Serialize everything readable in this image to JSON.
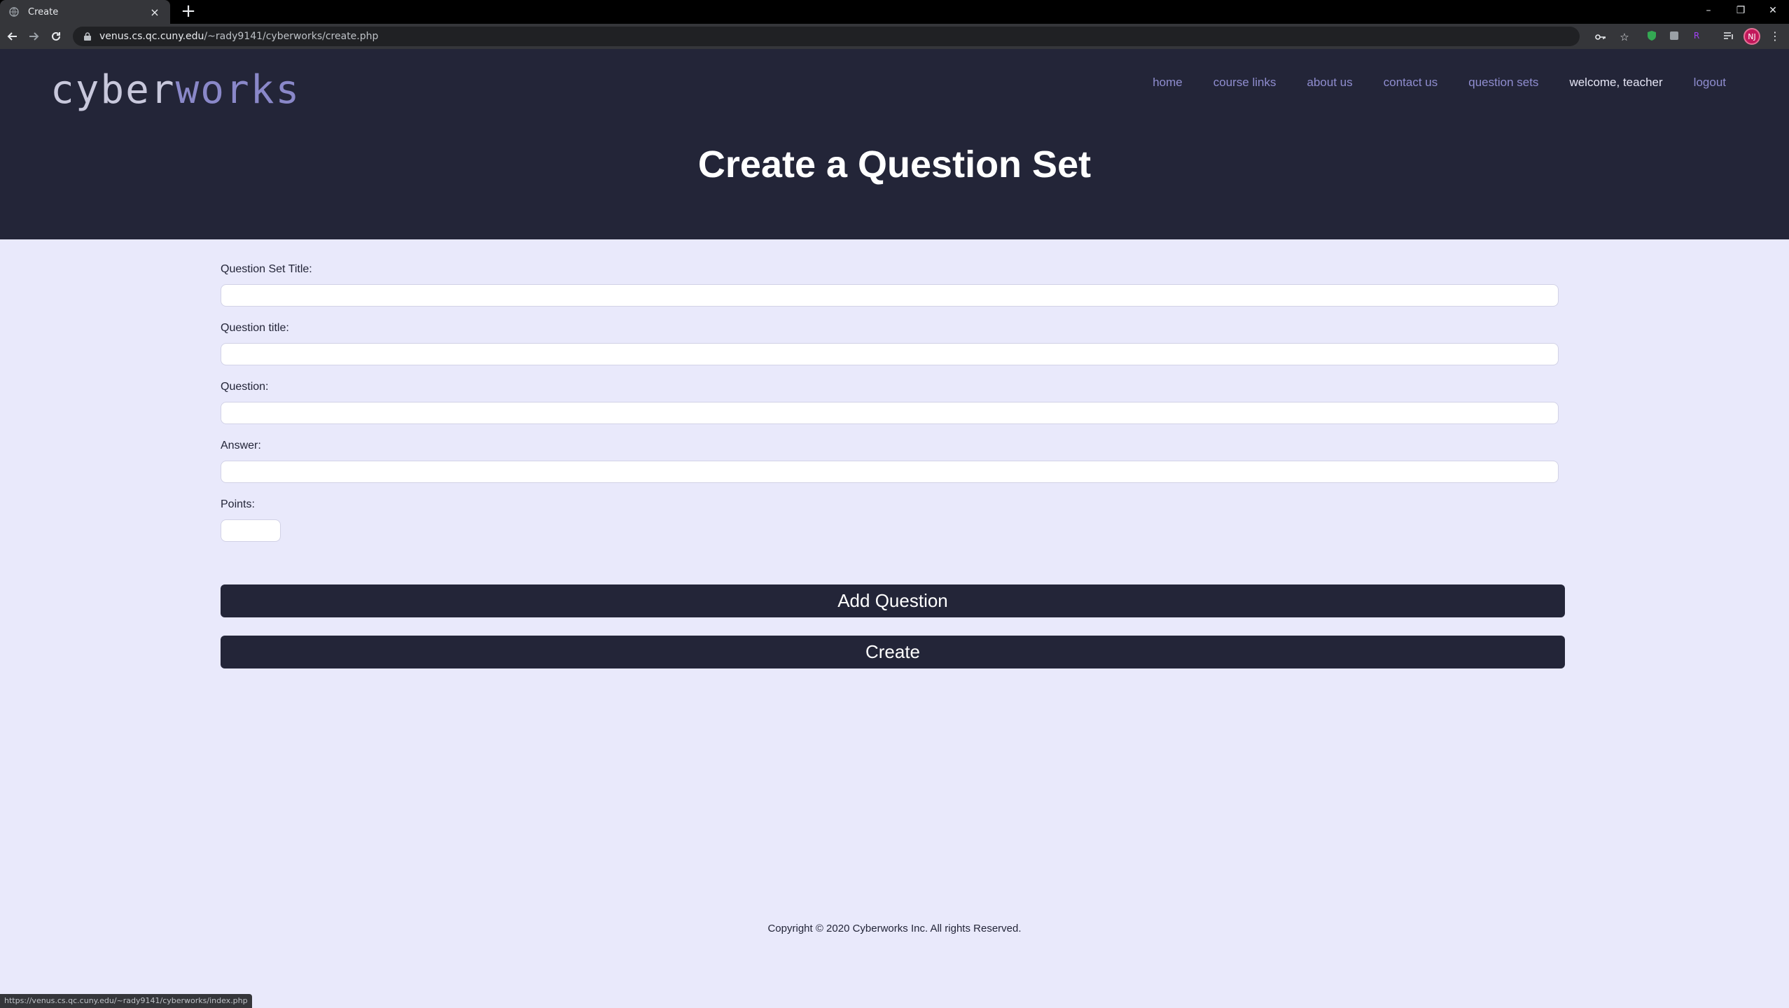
{
  "browser": {
    "tab_title": "Create",
    "tab_close": "×",
    "new_tab": "+",
    "url_host": "venus.cs.qc.cuny.edu",
    "url_path": "/~rady9141/cyberworks/create.php",
    "profile_initials": "NJ",
    "status_url": "https://venus.cs.qc.cuny.edu/~rady9141/cyberworks/index.php",
    "window_controls": {
      "minimize": "–",
      "restore": "❐",
      "close": "✕"
    }
  },
  "site": {
    "logo_part1": "cyber",
    "logo_part2": "works",
    "nav": [
      {
        "label": "home"
      },
      {
        "label": "course links"
      },
      {
        "label": "about us"
      },
      {
        "label": "contact us"
      },
      {
        "label": "question sets"
      },
      {
        "label": "welcome, teacher"
      },
      {
        "label": "logout"
      }
    ],
    "heading": "Create a Question Set"
  },
  "form": {
    "set_title_label": "Question Set Title:",
    "set_title_value": "",
    "question_title_label": "Question title:",
    "question_title_value": "",
    "question_label": "Question:",
    "question_value": "",
    "answer_label": "Answer:",
    "answer_value": "",
    "points_label": "Points:",
    "points_value": "",
    "add_button": "Add Question",
    "create_button": "Create"
  },
  "footer": {
    "copyright": "Copyright © 2020 Cyberworks Inc. All rights Reserved."
  },
  "colors": {
    "header_bg": "#232538",
    "page_bg": "#e9e9fb",
    "nav_link": "#8f8dcf",
    "button_bg": "#232538"
  }
}
